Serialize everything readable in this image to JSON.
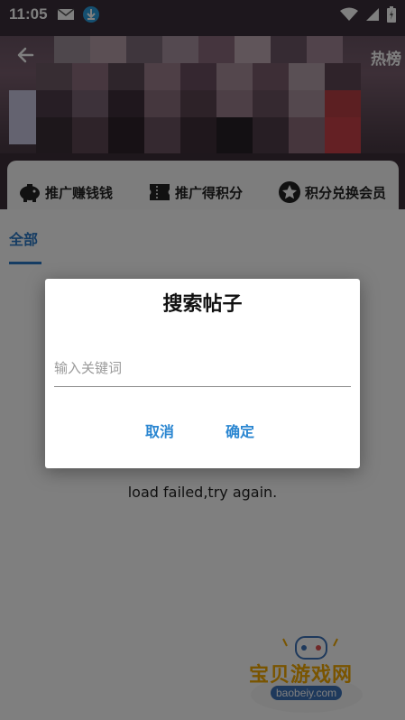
{
  "status_bar": {
    "time": "11:05",
    "icons": [
      "mail-icon",
      "download-icon",
      "wifi-icon",
      "signal-icon",
      "battery-charging-icon"
    ]
  },
  "header": {
    "hot_label": "热榜"
  },
  "menu": {
    "items": [
      {
        "label": "推广赚钱钱",
        "icon": "piggy-bank-icon"
      },
      {
        "label": "推广得积分",
        "icon": "ticket-icon"
      },
      {
        "label": "积分兑换会员",
        "icon": "star-badge-icon"
      }
    ]
  },
  "tabs": [
    {
      "label": "全部",
      "active": true
    }
  ],
  "content": {
    "load_failed": "load failed,try again."
  },
  "dialog": {
    "title": "搜索帖子",
    "input_placeholder": "输入关键词",
    "input_value": "",
    "cancel_label": "取消",
    "ok_label": "确定"
  },
  "watermark": {
    "text": "宝贝游戏网",
    "url": "baobeiy.com"
  },
  "colors": {
    "accent": "#2a78c7",
    "dialog_button": "#2a86d1",
    "watermark": "#f2a900"
  }
}
